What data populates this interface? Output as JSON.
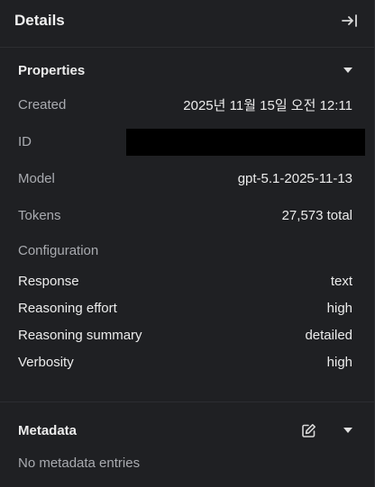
{
  "header": {
    "title": "Details",
    "collapse_icon": "collapse-right-icon"
  },
  "properties": {
    "title": "Properties",
    "toggle_icon": "caret-down-icon",
    "created": {
      "label": "Created",
      "value": "2025년 11월 15일 오전 12:11"
    },
    "id": {
      "label": "ID",
      "value": ""
    },
    "model": {
      "label": "Model",
      "value": "gpt-5.1-2025-11-13"
    },
    "tokens": {
      "label": "Tokens",
      "value": "27,573 total"
    },
    "configuration": {
      "title": "Configuration",
      "items": [
        {
          "label": "Response",
          "value": "text"
        },
        {
          "label": "Reasoning effort",
          "value": "high"
        },
        {
          "label": "Reasoning summary",
          "value": "detailed"
        },
        {
          "label": "Verbosity",
          "value": "high"
        }
      ]
    }
  },
  "metadata": {
    "title": "Metadata",
    "edit_icon": "edit-icon",
    "toggle_icon": "caret-down-icon",
    "empty_text": "No metadata entries"
  },
  "colors": {
    "background": "#1f2023",
    "text": "#ececec",
    "muted": "#a9abb0",
    "divider": "#2c2d31"
  }
}
